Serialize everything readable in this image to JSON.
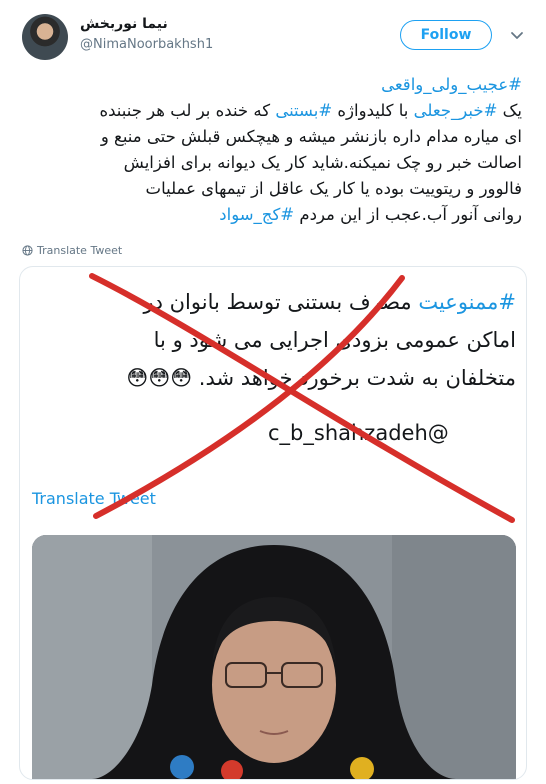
{
  "user": {
    "display_name": "نیما نوربخش",
    "handle": "@NimaNoorbakhsh1",
    "follow_label": "Follow"
  },
  "tweet": {
    "hashtag_title": "#عجیب_ولی_واقعی",
    "line1_pre": "یک ",
    "line1_tag1": "#خبر_جعلی",
    "line1_mid": " با کلیدواژه ",
    "line1_tag2": "#بستنی",
    "line1_post": " که خنده بر لب هر جنبنده",
    "line2": "ای میاره مدام داره بازنشر میشه و هیچکس قبلش حتی منبع و",
    "line3": "اصالت خبر رو چک نمیکنه.شاید کار یک دیوانه برای افزایش",
    "line4": "فالوور و ریتوییت بوده یا کار یک عاقل از تیمهای عملیات",
    "line5_pre": "روانی آنور آب.عجب از این مردم ",
    "line5_tag": "#کج_سواد",
    "translate_label": "Translate Tweet"
  },
  "quoted": {
    "line1_tag": "#ممنوعیت",
    "line1_rest": " مصرف بستنی توسط بانوان در",
    "line2": "اماکن عمومی بزودی اجرایی می شود و با",
    "line3": "متخلفان به شدت برخورد خواهد شد. 😳😳😳",
    "handle": "c_b_shahzadeh@",
    "translate_label": "Translate Tweet"
  },
  "colors": {
    "accent": "#1da1f2",
    "hashtag": "#1b95e0",
    "cross": "#d62f2a"
  },
  "icons": {
    "more": "chevron-down-icon",
    "translate": "globe-icon"
  }
}
